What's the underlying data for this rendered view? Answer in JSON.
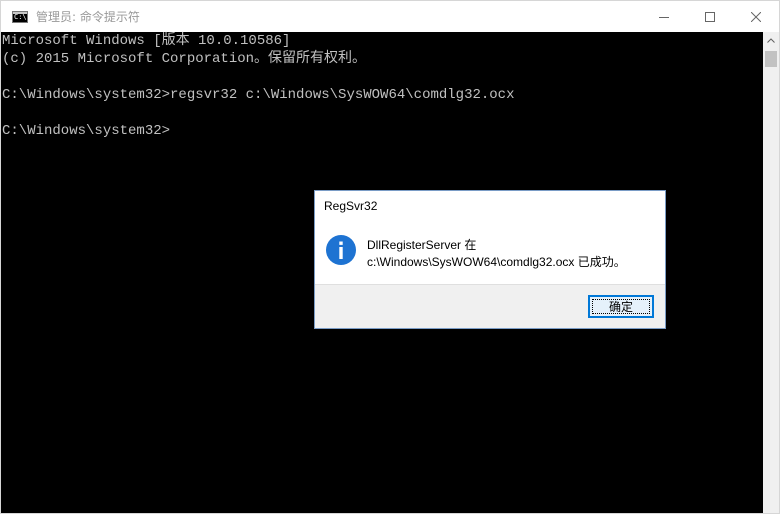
{
  "window": {
    "title": "管理员: 命令提示符"
  },
  "console": {
    "lines": [
      "Microsoft Windows [版本 10.0.10586]",
      "(c) 2015 Microsoft Corporation。保留所有权利。",
      "",
      "C:\\Windows\\system32>regsvr32 c:\\Windows\\SysWOW64\\comdlg32.ocx",
      "",
      "C:\\Windows\\system32>"
    ]
  },
  "dialog": {
    "title": "RegSvr32",
    "icon": "info-icon",
    "message_line1": "DllRegisterServer 在",
    "message_line2": "c:\\Windows\\SysWOW64\\comdlg32.ocx 已成功。",
    "ok_label": "确定"
  },
  "colors": {
    "console_bg": "#000000",
    "console_text": "#c0c0c0",
    "accent": "#0078d7",
    "info_icon": "#1e73d2"
  }
}
